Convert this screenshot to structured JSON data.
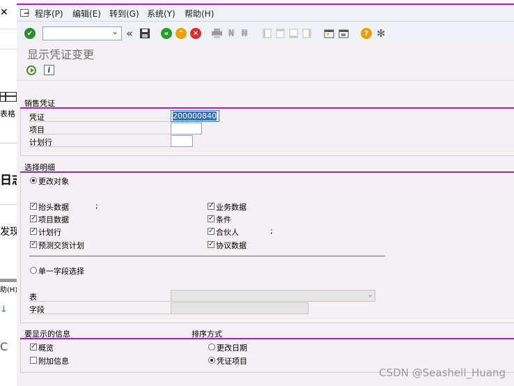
{
  "menu": {
    "items": [
      "程序(P)",
      "编辑(E)",
      "转到(G)",
      "系统(Y)",
      "帮助(H)"
    ]
  },
  "title": "显示凭证变更",
  "sales_document": {
    "section_title": "销售凭证",
    "document_label": "凭证",
    "document_value": "200000840",
    "item_label": "项目",
    "item_value": "",
    "schedule_line_label": "计划行",
    "schedule_line_value": ""
  },
  "selection_detail": {
    "section_title": "选择明细",
    "change_objects_label": "更改对象",
    "change_objects_selected": true,
    "checkboxes_left": [
      {
        "label": "抬头数据",
        "checked": true,
        "suffix": ";"
      },
      {
        "label": "项目数据",
        "checked": true,
        "suffix": ""
      },
      {
        "label": "计划行",
        "checked": true,
        "suffix": ""
      },
      {
        "label": "预测交货计划",
        "checked": true,
        "suffix": ""
      }
    ],
    "checkboxes_right": [
      {
        "label": "业务数据",
        "checked": true,
        "suffix": ""
      },
      {
        "label": "条件",
        "checked": true,
        "suffix": ""
      },
      {
        "label": "合伙人",
        "checked": true,
        "suffix": ";"
      },
      {
        "label": "协议数据",
        "checked": true,
        "suffix": ""
      }
    ],
    "single_field_label": "单一字段选择",
    "single_field_selected": false,
    "table_label": "表",
    "table_value": "",
    "field_label": "字段",
    "field_value": ""
  },
  "display_info": {
    "section_title": "要显示的信息",
    "overview_label": "概览",
    "overview_checked": true,
    "additional_label": "附加信息",
    "additional_checked": false
  },
  "sort_order": {
    "section_title": "排序方式",
    "change_date_label": "更改日期",
    "change_date_selected": false,
    "document_item_label": "凭证项目",
    "document_item_selected": true
  },
  "background_window": {
    "close_glyph": "✕",
    "table_label": "表格",
    "fragment_log": "日志",
    "fragment_find": "发现",
    "fragment_help": "助(H)",
    "fragment_arrow": "↓",
    "fragment_c": "C"
  },
  "watermark": "CSDN @Seashell_Huang",
  "colors": {
    "accent_purple": "#a020c0",
    "selection_blue": "#3b6db0",
    "background": "#f4f0f4"
  },
  "icons": [
    "enter-check-icon",
    "back-icon",
    "save-icon",
    "back-green-icon",
    "exit-icon",
    "cancel-icon",
    "print-icon",
    "find-icon",
    "find-next-icon",
    "first-page-icon",
    "prev-page-icon",
    "next-page-icon",
    "last-page-icon",
    "create-session-icon",
    "shortcut-icon",
    "help-icon",
    "customize-icon",
    "execute-icon",
    "info-icon"
  ]
}
